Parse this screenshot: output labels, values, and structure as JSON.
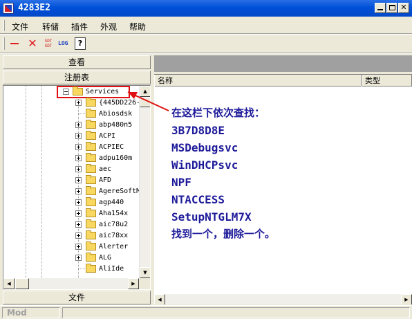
{
  "window": {
    "title": "4283E2"
  },
  "menu": [
    "文件",
    "转储",
    "插件",
    "外观",
    "帮助"
  ],
  "toolbar": {
    "sdt_label": "SDT SDT",
    "log_label": "LOG",
    "help_glyph": "?"
  },
  "left_panel": {
    "tab_view": "查看",
    "tab_registry": "注册表",
    "tab_file": "文件",
    "tree": {
      "selected": "Services",
      "children": [
        "{445DD226-",
        "Abiosdsk",
        "abp480n5",
        "ACPI",
        "ACPIEC",
        "adpu160m",
        "aec",
        "AFD",
        "AgereSoftM",
        "agp440",
        "Aha154x",
        "aic78u2",
        "aic78xx",
        "Alerter",
        "ALG",
        "AliIde"
      ]
    }
  },
  "list": {
    "columns": [
      "名称",
      "类型"
    ]
  },
  "annotation": {
    "lines": [
      "在这栏下依次查找：",
      "3B7D8D8E",
      "MSDebugsvc",
      "WinDHCPsvc",
      "NPF",
      "NTACCESS",
      "SetupNTGLM7X",
      "找到一个，删除一个。"
    ],
    "color": "#1e1b9a",
    "arrow_color": "#e01010"
  },
  "status": {
    "left": "Mod"
  },
  "colors": {
    "titlebar": "#0050d8",
    "highlight_box": "#e01010",
    "folder": "#f8d860"
  }
}
